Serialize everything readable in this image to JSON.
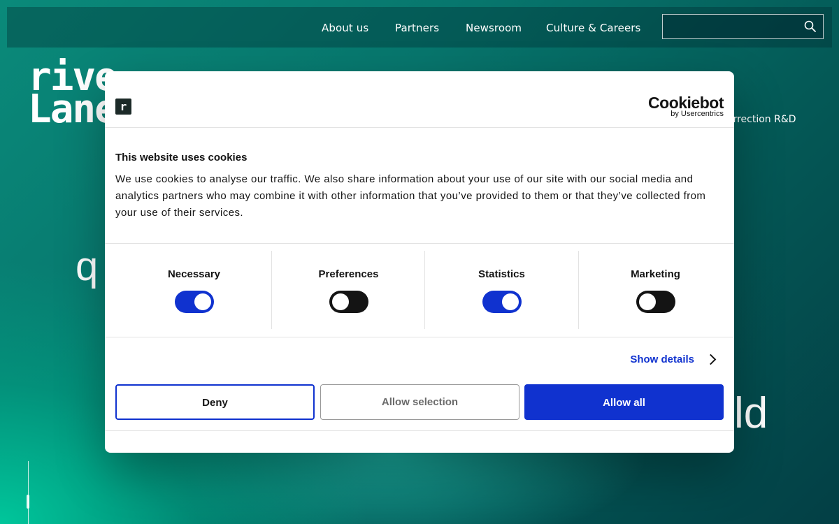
{
  "nav": {
    "items": [
      "About us",
      "Partners",
      "Newsroom",
      "Culture & Careers"
    ],
    "search_placeholder": ""
  },
  "logo": {
    "line1": "rive",
    "line2": "Lane"
  },
  "background_text": {
    "subnav_partial": "orrection R&D",
    "hero_left_partial": "q",
    "hero_right_partial": "ld"
  },
  "cookie_dialog": {
    "site_logo_letter": "r",
    "provider_name": "Cookiebot",
    "provider_sub": "by Usercentrics",
    "title": "This website uses cookies",
    "body": "We use cookies to analyse our traffic. We also share information about your use of our site with our social media and analytics partners who may combine it with other information that you’ve provided to them or that they’ve collected from your use of their services.",
    "categories": [
      {
        "label": "Necessary",
        "enabled": true
      },
      {
        "label": "Preferences",
        "enabled": false
      },
      {
        "label": "Statistics",
        "enabled": true
      },
      {
        "label": "Marketing",
        "enabled": false
      }
    ],
    "show_details": "Show details",
    "buttons": {
      "deny": "Deny",
      "allow_selection": "Allow selection",
      "allow_all": "Allow all"
    }
  },
  "colors": {
    "accent": "#1032cf",
    "switch_off": "#141414",
    "bg_teal": "#07766d"
  }
}
